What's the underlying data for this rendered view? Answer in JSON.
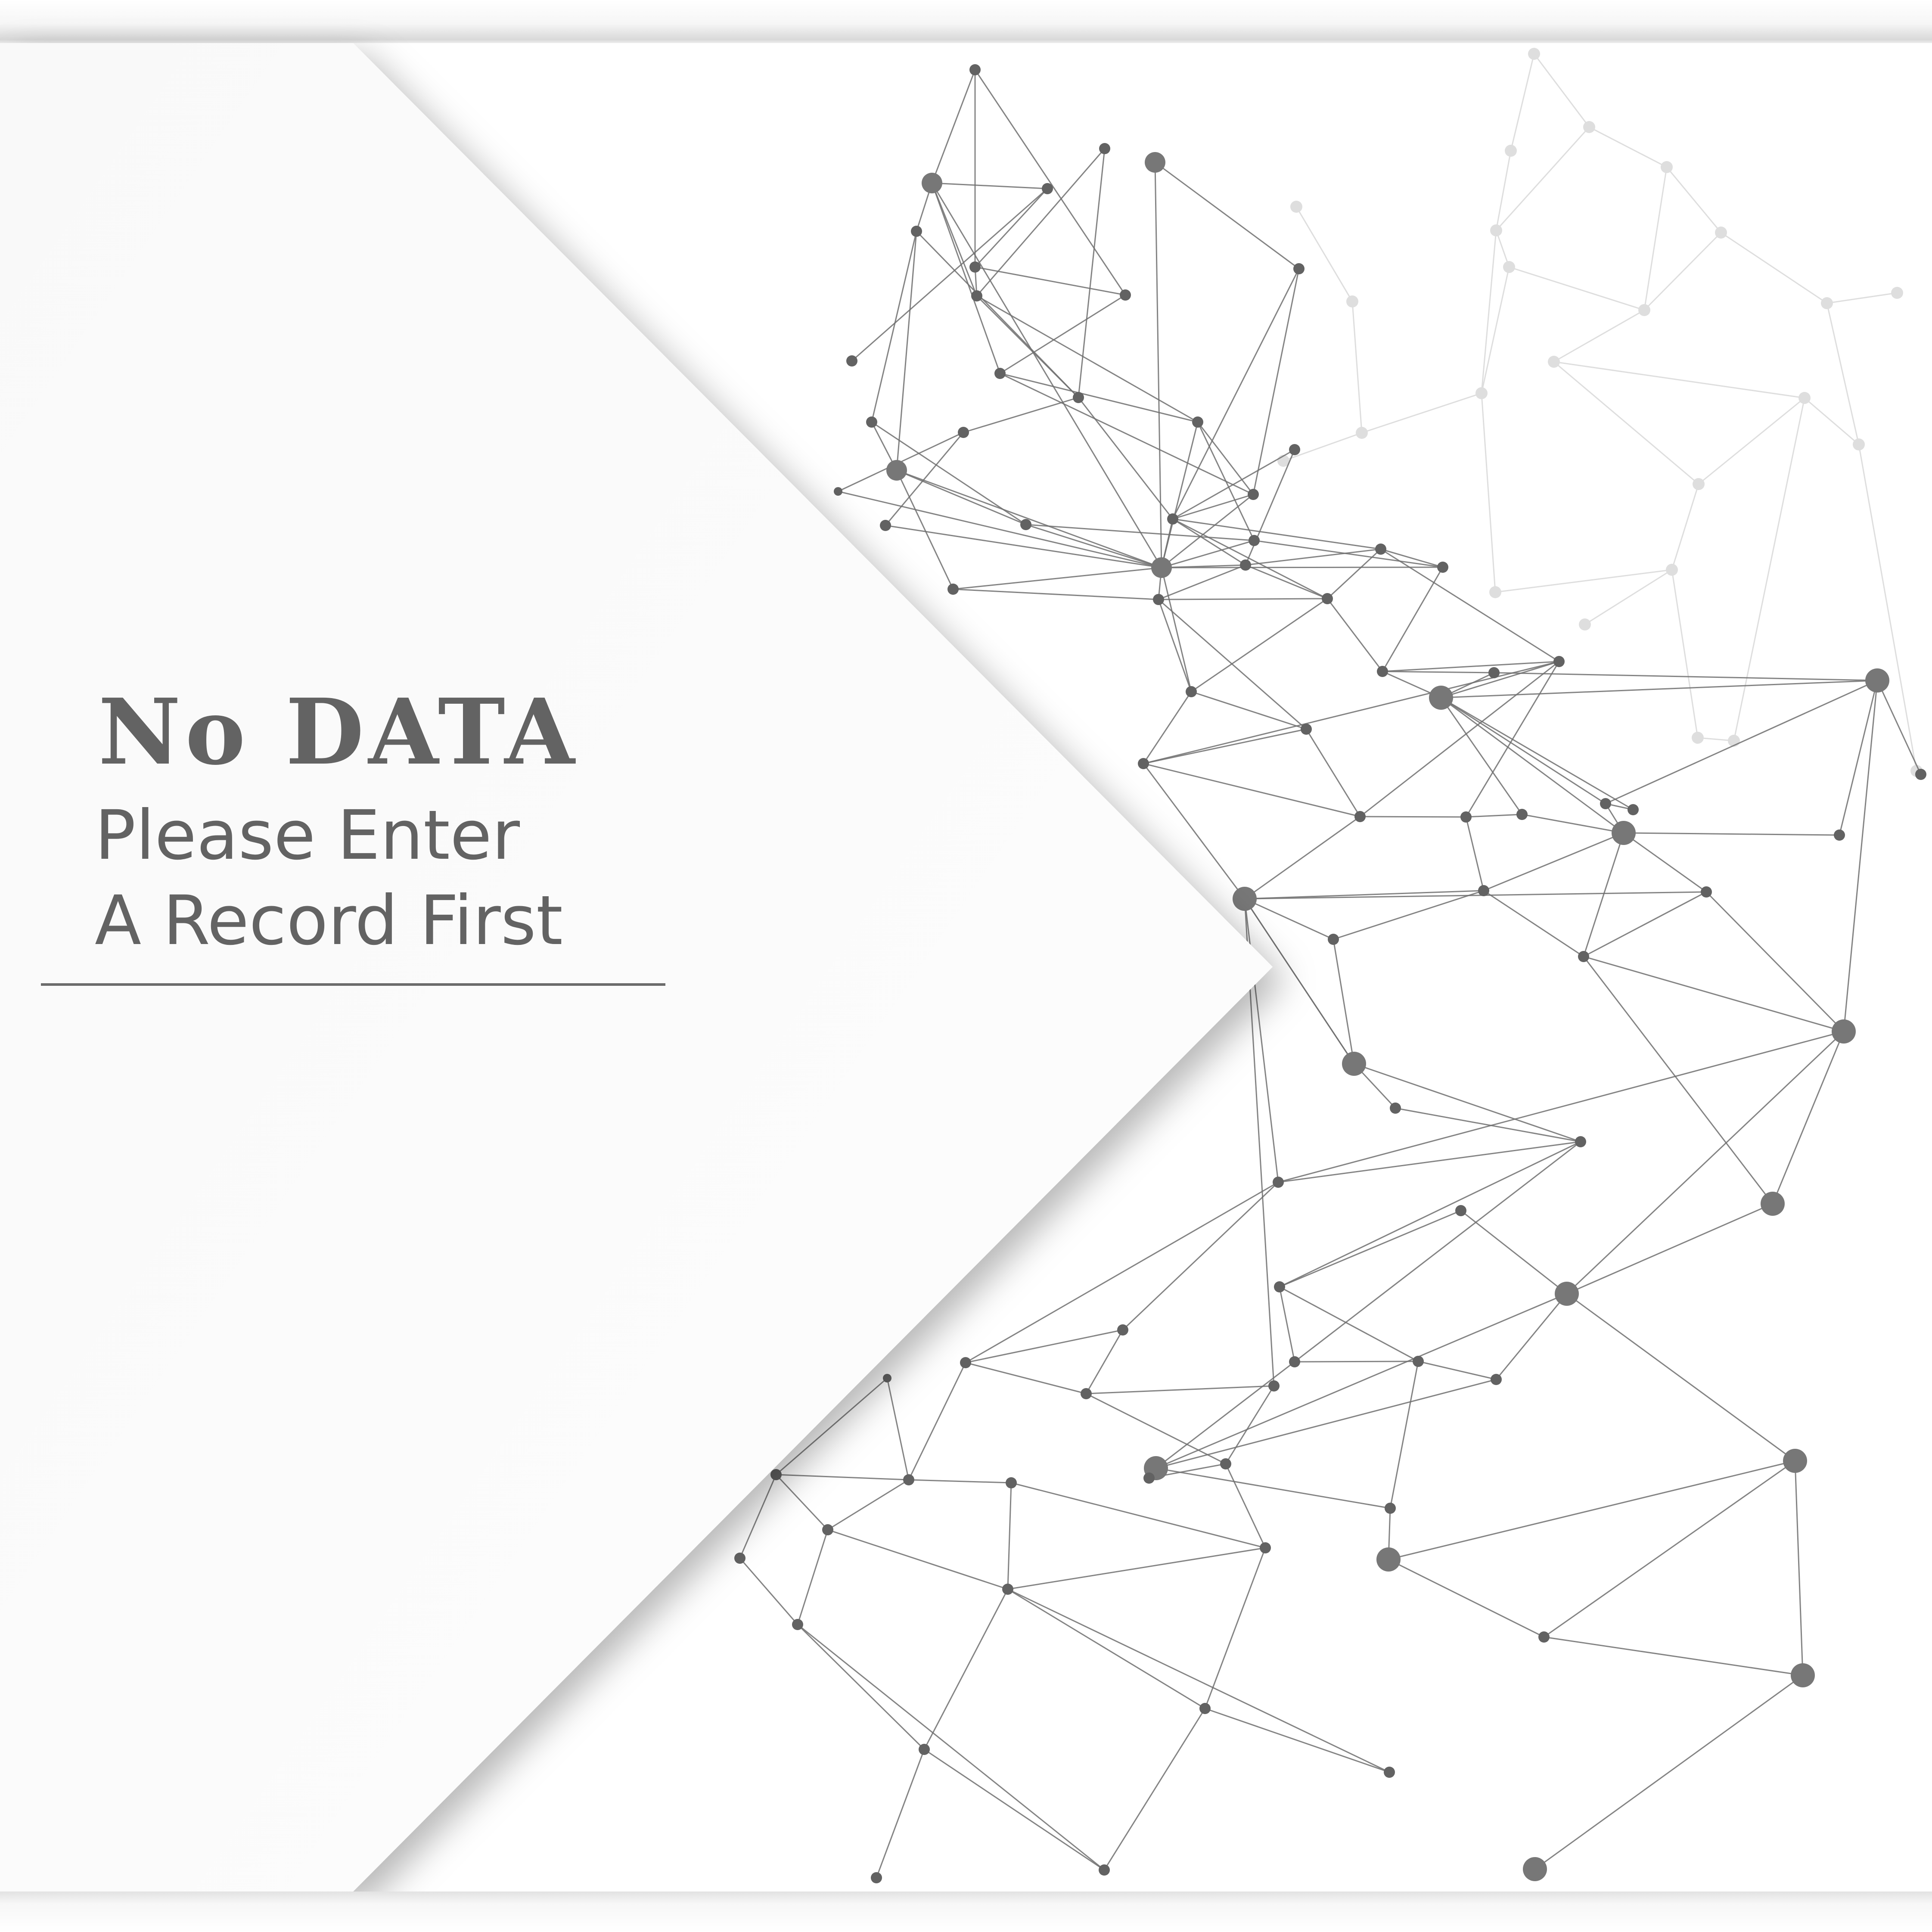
{
  "message": {
    "title": "No DATA",
    "line1": "Please Enter",
    "line2": "A Record First"
  },
  "colors": {
    "background": "#ffffff",
    "panel": "#fbfbfb",
    "text": "#636363",
    "node": "#626262",
    "line": "#6e6e6e"
  }
}
